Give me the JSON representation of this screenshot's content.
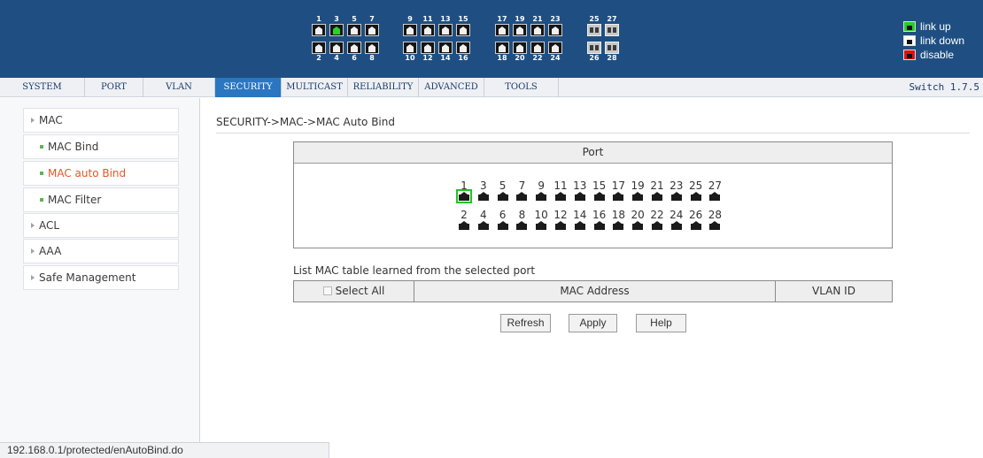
{
  "header": {
    "panel_top_labels": [
      "1",
      "3",
      "5",
      "7",
      "9",
      "11",
      "13",
      "15",
      "17",
      "19",
      "21",
      "23",
      "25",
      "27"
    ],
    "panel_bottom_labels": [
      "2",
      "4",
      "6",
      "8",
      "10",
      "12",
      "14",
      "16",
      "18",
      "20",
      "22",
      "24",
      "26",
      "28"
    ],
    "panel_top_status": [
      "down",
      "up",
      "down",
      "down",
      "down",
      "down",
      "down",
      "down",
      "down",
      "down",
      "down",
      "down",
      "sfp",
      "sfp"
    ],
    "panel_bottom_status": [
      "down",
      "down",
      "down",
      "down",
      "down",
      "down",
      "down",
      "down",
      "down",
      "down",
      "down",
      "down",
      "sfp",
      "sfp"
    ],
    "legend": {
      "link_up": "link up",
      "link_down": "link down",
      "disable": "disable"
    }
  },
  "menu": {
    "tabs": [
      {
        "label": "SYSTEM"
      },
      {
        "label": "PORT"
      },
      {
        "label": "VLAN"
      },
      {
        "label": "SECURITY",
        "active": true
      },
      {
        "label": "MULTICAST"
      },
      {
        "label": "RELIABILITY"
      },
      {
        "label": "ADVANCED"
      },
      {
        "label": "TOOLS"
      }
    ],
    "version": "Switch 1.7.5"
  },
  "sidebar": {
    "items": [
      {
        "label": "MAC",
        "type": "section"
      },
      {
        "label": "MAC Bind",
        "type": "sub"
      },
      {
        "label": "MAC auto Bind",
        "type": "sub",
        "current": true
      },
      {
        "label": "MAC Filter",
        "type": "sub"
      },
      {
        "label": "ACL",
        "type": "section"
      },
      {
        "label": "AAA",
        "type": "section"
      },
      {
        "label": "Safe Management",
        "type": "section"
      }
    ]
  },
  "main": {
    "breadcrumb": "SECURITY->MAC->MAC Auto Bind",
    "port_panel": {
      "header": "Port",
      "top_labels": [
        "1",
        "3",
        "5",
        "7",
        "9",
        "11",
        "13",
        "15",
        "17",
        "19",
        "21",
        "23",
        "25",
        "27"
      ],
      "bottom_labels": [
        "2",
        "4",
        "6",
        "8",
        "10",
        "12",
        "14",
        "16",
        "18",
        "20",
        "22",
        "24",
        "26",
        "28"
      ],
      "selected_port": "1"
    },
    "list_title": "List MAC table learned from the selected port",
    "table": {
      "select_all": "Select All",
      "mac_address": "MAC Address",
      "vlan_id": "VLAN ID"
    },
    "buttons": {
      "refresh": "Refresh",
      "apply": "Apply",
      "help": "Help"
    }
  },
  "status_bar": {
    "url": "192.168.0.1/protected/enAutoBind.do"
  }
}
